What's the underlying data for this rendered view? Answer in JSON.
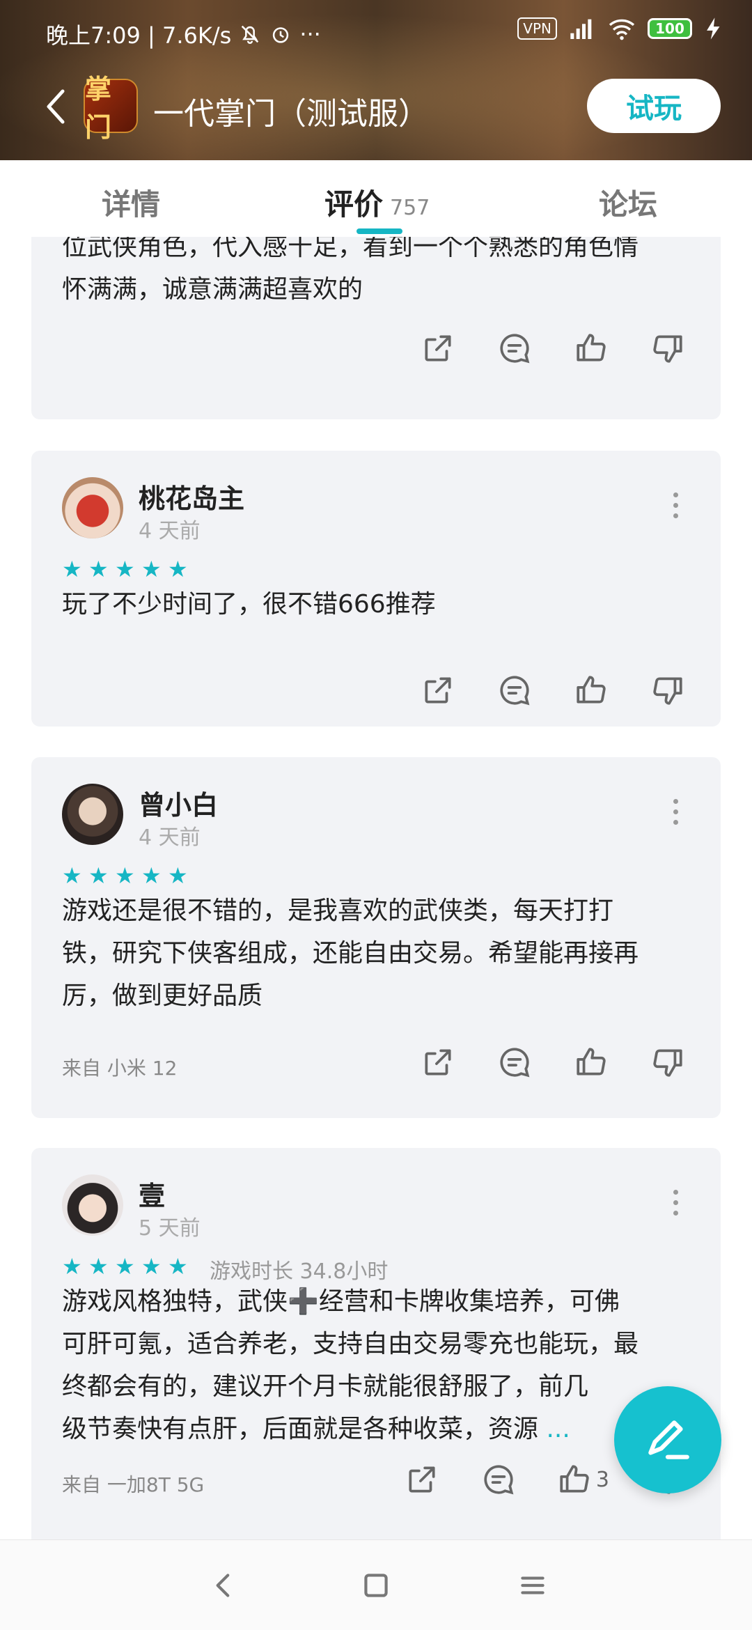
{
  "status_bar": {
    "time_text": "晚上7:09 | 7.6K/s",
    "vpn": "VPN",
    "battery": "100"
  },
  "app_bar": {
    "title": "一代掌门（测试服）",
    "icon_text": "掌门",
    "try_button": "试玩"
  },
  "tabs": {
    "details": "详情",
    "reviews": "评价",
    "reviews_count": "757",
    "forum": "论坛"
  },
  "reviews": [
    {
      "partial": true,
      "text_lines": [
        "位武侠角色，代入感十足，看到一个个熟悉的角色情",
        "怀满满，诚意满满超喜欢的"
      ]
    },
    {
      "name": "桃花岛主",
      "time": "4 天前",
      "stars": 5,
      "text": "玩了不少时间了，很不错666推荐"
    },
    {
      "name": "曾小白",
      "time": "4 天前",
      "stars": 5,
      "text_lines": [
        "游戏还是很不错的，是我喜欢的武侠类，每天打打",
        "铁，研究下侠客组成，还能自由交易。希望能再接再",
        "厉，做到更好品质"
      ],
      "device": "来自 小米 12"
    },
    {
      "name": "壹",
      "time": "5 天前",
      "stars": 5,
      "playtime": "游戏时长 34.8小时",
      "text_lines": [
        "游戏风格独特，武侠➕经营和卡牌收集培养，可佛",
        "可肝可氪，适合养老，支持自由交易零充也能玩，最",
        "终都会有的，建议开个月卡就能很舒服了，前几",
        "级节奏快有点肝，后面就是各种收菜，资源"
      ],
      "ellipsis": "...",
      "device": "来自 一加8T 5G",
      "likes": "3"
    }
  ],
  "colors": {
    "accent": "#16b6c4",
    "card_bg": "#f2f3f6"
  }
}
